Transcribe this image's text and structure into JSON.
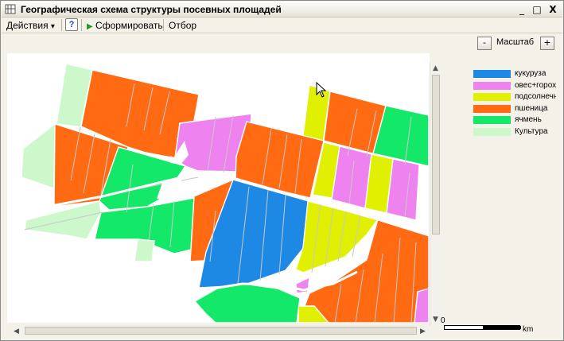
{
  "window": {
    "title": "Географическая схема структуры посевных площадей",
    "minimize": "_",
    "maximize": "□",
    "close": "X"
  },
  "toolbar": {
    "actions_label": "Действия",
    "actions_arrow": "▾",
    "help_label": "?",
    "run_icon": "▶",
    "run_label": "Сформировать",
    "filter_label": "Отбор"
  },
  "zoom": {
    "minus_label": "-",
    "label": "Масштаб",
    "plus_label": "+"
  },
  "legend": [
    {
      "label": "кукуруза",
      "color": "#1e88e5"
    },
    {
      "label": "овес+горох",
      "color": "#ee82ee"
    },
    {
      "label": "подсолнечник",
      "color": "#e0f000"
    },
    {
      "label": "пшеница",
      "color": "#ff6a13"
    },
    {
      "label": "ячмень",
      "color": "#14e868"
    },
    {
      "label": "Культура",
      "color": "#ccf8cc"
    }
  ],
  "scale": {
    "zero": "0",
    "unit": "km"
  },
  "colors": {
    "corn": "#1e88e5",
    "oats_peas": "#ee82ee",
    "sunflower": "#e0f000",
    "wheat": "#ff6a13",
    "barley": "#14e868",
    "culture": "#ccf8cc"
  }
}
